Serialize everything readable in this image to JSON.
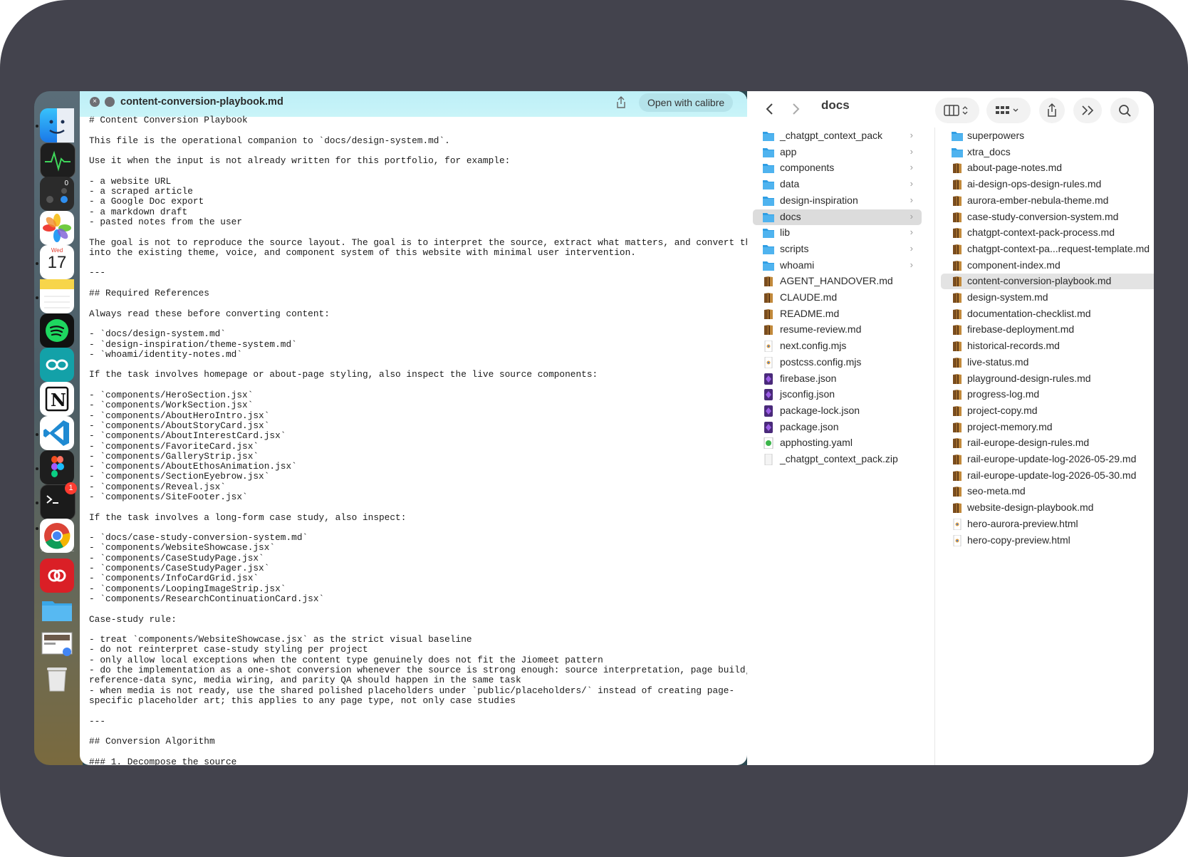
{
  "quicklook": {
    "filename": "content-conversion-playbook.md",
    "open_with": "Open with calibre",
    "content": "# Content Conversion Playbook\n\nThis file is the operational companion to `docs/design-system.md`.\n\nUse it when the input is not already written for this portfolio, for example:\n\n- a website URL\n- a scraped article\n- a Google Doc export\n- a markdown draft\n- pasted notes from the user\n\nThe goal is not to reproduce the source layout. The goal is to interpret the source, extract what matters, and convert that\ninto the existing theme, voice, and component system of this website with minimal user intervention.\n\n---\n\n## Required References\n\nAlways read these before converting content:\n\n- `docs/design-system.md`\n- `design-inspiration/theme-system.md`\n- `whoami/identity-notes.md`\n\nIf the task involves homepage or about-page styling, also inspect the live source components:\n\n- `components/HeroSection.jsx`\n- `components/WorkSection.jsx`\n- `components/AboutHeroIntro.jsx`\n- `components/AboutStoryCard.jsx`\n- `components/AboutInterestCard.jsx`\n- `components/FavoriteCard.jsx`\n- `components/GalleryStrip.jsx`\n- `components/AboutEthosAnimation.jsx`\n- `components/SectionEyebrow.jsx`\n- `components/Reveal.jsx`\n- `components/SiteFooter.jsx`\n\nIf the task involves a long-form case study, also inspect:\n\n- `docs/case-study-conversion-system.md`\n- `components/WebsiteShowcase.jsx`\n- `components/CaseStudyPage.jsx`\n- `components/CaseStudyPager.jsx`\n- `components/InfoCardGrid.jsx`\n- `components/LoopingImageStrip.jsx`\n- `components/ResearchContinuationCard.jsx`\n\nCase-study rule:\n\n- treat `components/WebsiteShowcase.jsx` as the strict visual baseline\n- do not reinterpret case-study styling per project\n- only allow local exceptions when the content type genuinely does not fit the Jiomeet pattern\n- do the implementation as a one-shot conversion whenever the source is strong enough: source interpretation, page build,\nreference-data sync, media wiring, and parity QA should happen in the same task\n- when media is not ready, use the shared polished placeholders under `public/placeholders/` instead of creating page-\nspecific placeholder art; this applies to any page type, not only case studies\n\n---\n\n## Conversion Algorithm\n\n### 1. Decompose the source",
    "colors": {
      "bar": "#bdeff7",
      "button": "#b4e3ea"
    }
  },
  "dock": {
    "calendar_day": "Wed",
    "calendar_date": "17",
    "calculator_display": "0",
    "terminal_badge": "1",
    "icons": [
      "finder-icon",
      "activity-monitor-icon",
      "calculator-icon",
      "photos-icon",
      "calendar-icon",
      "notes-icon",
      "spotify-icon",
      "arduino-icon",
      "notion-icon",
      "vscode-icon",
      "figma-icon",
      "terminal-icon",
      "chrome-icon",
      "creative-cloud-icon",
      "folder-icon",
      "preview-thumbnail-icon",
      "trash-icon"
    ]
  },
  "finder": {
    "path_title": "docs",
    "column1": [
      {
        "name": "_chatgpt_context_pack",
        "type": "folder",
        "chevron": true
      },
      {
        "name": "app",
        "type": "folder",
        "chevron": true
      },
      {
        "name": "components",
        "type": "folder",
        "chevron": true
      },
      {
        "name": "data",
        "type": "folder",
        "chevron": true
      },
      {
        "name": "design-inspiration",
        "type": "folder",
        "chevron": true
      },
      {
        "name": "docs",
        "type": "folder",
        "chevron": true,
        "selected": true
      },
      {
        "name": "lib",
        "type": "folder",
        "chevron": true
      },
      {
        "name": "scripts",
        "type": "folder",
        "chevron": true
      },
      {
        "name": "whoami",
        "type": "folder",
        "chevron": true
      },
      {
        "name": "AGENT_HANDOVER.md",
        "type": "md"
      },
      {
        "name": "CLAUDE.md",
        "type": "md"
      },
      {
        "name": "README.md",
        "type": "md"
      },
      {
        "name": "resume-review.md",
        "type": "md"
      },
      {
        "name": "next.config.mjs",
        "type": "mjs"
      },
      {
        "name": "postcss.config.mjs",
        "type": "mjs"
      },
      {
        "name": "firebase.json",
        "type": "json"
      },
      {
        "name": "jsconfig.json",
        "type": "json"
      },
      {
        "name": "package-lock.json",
        "type": "json"
      },
      {
        "name": "package.json",
        "type": "json"
      },
      {
        "name": "apphosting.yaml",
        "type": "yaml"
      },
      {
        "name": "_chatgpt_context_pack.zip",
        "type": "zip"
      }
    ],
    "column2": [
      {
        "name": "superpowers",
        "type": "folder"
      },
      {
        "name": "xtra_docs",
        "type": "folder"
      },
      {
        "name": "about-page-notes.md",
        "type": "md"
      },
      {
        "name": "ai-design-ops-design-rules.md",
        "type": "md"
      },
      {
        "name": "aurora-ember-nebula-theme.md",
        "type": "md"
      },
      {
        "name": "case-study-conversion-system.md",
        "type": "md"
      },
      {
        "name": "chatgpt-context-pack-process.md",
        "type": "md"
      },
      {
        "name": "chatgpt-context-pa...request-template.md",
        "type": "md"
      },
      {
        "name": "component-index.md",
        "type": "md"
      },
      {
        "name": "content-conversion-playbook.md",
        "type": "md",
        "selected": true
      },
      {
        "name": "design-system.md",
        "type": "md"
      },
      {
        "name": "documentation-checklist.md",
        "type": "md"
      },
      {
        "name": "firebase-deployment.md",
        "type": "md"
      },
      {
        "name": "historical-records.md",
        "type": "md"
      },
      {
        "name": "live-status.md",
        "type": "md"
      },
      {
        "name": "playground-design-rules.md",
        "type": "md"
      },
      {
        "name": "progress-log.md",
        "type": "md"
      },
      {
        "name": "project-copy.md",
        "type": "md"
      },
      {
        "name": "project-memory.md",
        "type": "md"
      },
      {
        "name": "rail-europe-design-rules.md",
        "type": "md"
      },
      {
        "name": "rail-europe-update-log-2026-05-29.md",
        "type": "md"
      },
      {
        "name": "rail-europe-update-log-2026-05-30.md",
        "type": "md"
      },
      {
        "name": "seo-meta.md",
        "type": "md"
      },
      {
        "name": "website-design-playbook.md",
        "type": "md"
      },
      {
        "name": "hero-aurora-preview.html",
        "type": "html"
      },
      {
        "name": "hero-copy-preview.html",
        "type": "html"
      }
    ],
    "colors": {
      "folder": "#3aa7e8",
      "selection": "#dcdcdc"
    }
  }
}
